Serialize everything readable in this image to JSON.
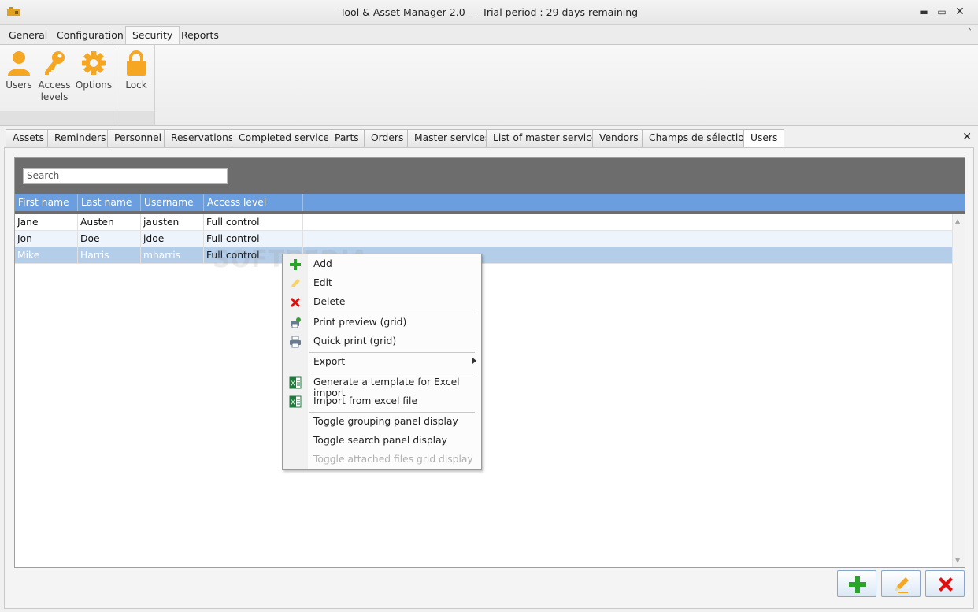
{
  "window": {
    "title": "Tool & Asset Manager 2.0 --- Trial period : 29 days remaining",
    "minimize": "▬",
    "maximize": "▭",
    "close": "✕"
  },
  "menu_tabs": [
    {
      "label": "General"
    },
    {
      "label": "Configuration"
    },
    {
      "label": "Security",
      "active": true
    },
    {
      "label": "Reports"
    }
  ],
  "ribbon": {
    "users": "Users",
    "access_levels_line1": "Access",
    "access_levels_line2": "levels",
    "options": "Options",
    "lock": "Lock",
    "icon_color": "#f5a623"
  },
  "doc_tabs": [
    {
      "label": "Assets"
    },
    {
      "label": "Reminders"
    },
    {
      "label": "Personnel"
    },
    {
      "label": "Reservations"
    },
    {
      "label": "Completed services"
    },
    {
      "label": "Parts"
    },
    {
      "label": "Orders"
    },
    {
      "label": "Master services"
    },
    {
      "label": "List of master services"
    },
    {
      "label": "Vendors"
    },
    {
      "label": "Champs de sélection"
    },
    {
      "label": "Users",
      "active": true
    }
  ],
  "doc_close": "✕",
  "search": {
    "placeholder": "Search"
  },
  "grid": {
    "columns": [
      "First name",
      "Last name",
      "Username",
      "Access level"
    ],
    "rows": [
      [
        "Jane",
        "Austen",
        "jausten",
        "Full control"
      ],
      [
        "Jon",
        "Doe",
        "jdoe",
        "Full control"
      ],
      [
        "Mike",
        "Harris",
        "mharris",
        "Full control"
      ]
    ],
    "selected_row": 2,
    "header_color": "#6a9ede",
    "selected_color": "#b4cde9"
  },
  "context_menu": {
    "items": [
      {
        "label": "Add",
        "icon": "plus-icon"
      },
      {
        "label": "Edit",
        "icon": "pencil-icon"
      },
      {
        "label": "Delete",
        "icon": "x-icon"
      },
      {
        "label": "Print preview (grid)",
        "icon": "print-preview-icon"
      },
      {
        "label": "Quick print (grid)",
        "icon": "printer-icon"
      },
      {
        "label": "Export",
        "icon": "none",
        "submenu": true
      },
      {
        "label": "Generate a template for Excel import",
        "icon": "excel-icon"
      },
      {
        "label": "Import from excel file",
        "icon": "excel-icon"
      },
      {
        "label": "Toggle grouping panel display",
        "icon": "none"
      },
      {
        "label": "Toggle search panel display",
        "icon": "none"
      },
      {
        "label": "Toggle attached files grid display",
        "icon": "none",
        "disabled": true
      }
    ]
  },
  "watermark": "SOFTPEDIA",
  "colors": {
    "add": "#2aa52a",
    "edit": "#f5a623",
    "delete": "#e01010"
  }
}
